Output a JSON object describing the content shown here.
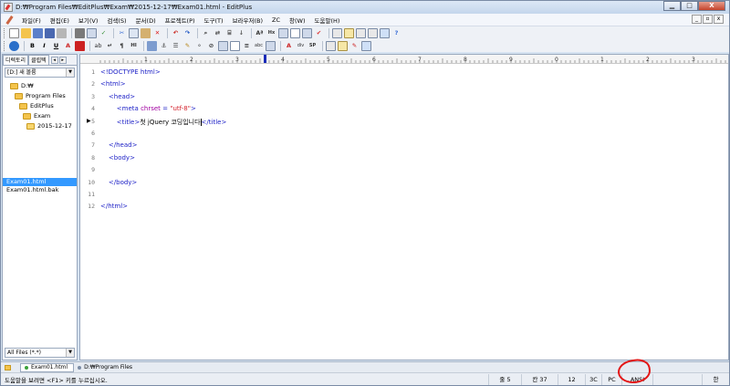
{
  "window": {
    "title": "D:₩Program Files₩EditPlus₩Exam₩2015-12-17₩Exam01.html - EditPlus",
    "buttons": [
      "▁",
      "□",
      "X"
    ]
  },
  "menu": {
    "items": [
      "파일(F)",
      "편집(E)",
      "보기(V)",
      "검색(S)",
      "문서(D)",
      "프로젝트(P)",
      "도구(T)",
      "브라우저(B)",
      "ZC",
      "창(W)",
      "도움말(H)"
    ],
    "mdi_buttons": [
      "_",
      "▫",
      "x"
    ]
  },
  "toolbar2": {
    "labels": [
      "B",
      "I",
      "U",
      "A",
      "ab",
      "¶",
      "Hl",
      "abc",
      "div",
      "SP"
    ]
  },
  "left_panel": {
    "tabs": [
      "디렉토리",
      "클립텍"
    ],
    "drive_select": "[D:] 새 볼륨",
    "tree": [
      "D:₩",
      "Program Files",
      "EditPlus",
      "Exam",
      "2015-12-17"
    ],
    "files": [
      "Exam01.html",
      "Exam01.html.bak"
    ],
    "filter": "All Files (*.*)"
  },
  "ruler": {
    "labels": [
      "1",
      "2",
      "3",
      "4",
      "5",
      "6",
      "7",
      "8",
      "9",
      "0",
      "1",
      "2",
      "3"
    ]
  },
  "editor": {
    "line_numbers": [
      "1",
      "2",
      "3",
      "4",
      "5",
      "6",
      "7",
      "8",
      "9",
      "10",
      "11",
      "12"
    ],
    "lines": [
      [
        {
          "t": "<!DOCTYPE html>",
          "c": "tag"
        }
      ],
      [
        {
          "t": "<html>",
          "c": "tag"
        }
      ],
      [
        {
          "t": "    <head>",
          "c": "tag"
        }
      ],
      [
        {
          "t": "        <meta ",
          "c": "tag"
        },
        {
          "t": "chrset",
          "c": "attr"
        },
        {
          "t": " = ",
          "c": "tag"
        },
        {
          "t": "\"utf-8\"",
          "c": "val"
        },
        {
          "t": ">",
          "c": "tag"
        }
      ],
      [
        {
          "t": "        <title>",
          "c": "tag"
        },
        {
          "t": "첫 jQuery 코딩입니다",
          "c": "txt"
        },
        {
          "t": "|",
          "c": "caret"
        },
        {
          "t": "</title>",
          "c": "tag"
        }
      ],
      [],
      [
        {
          "t": "    </head>",
          "c": "tag"
        }
      ],
      [
        {
          "t": "    <body>",
          "c": "tag"
        }
      ],
      [],
      [
        {
          "t": "    </body>",
          "c": "tag"
        }
      ],
      [],
      [
        {
          "t": "</html>",
          "c": "tag"
        }
      ]
    ]
  },
  "doc_tabs": [
    {
      "label": "Exam01.html",
      "active": true
    },
    {
      "label": "D:₩Program Files",
      "active": false
    }
  ],
  "status": {
    "help": "도움말을 보려면 <F1> 키를 누르십시오.",
    "line": "줄 5",
    "col": "칸 37",
    "num": "12",
    "cells": [
      "3C",
      "PC",
      "ANSI",
      "",
      "한"
    ]
  },
  "colors": {
    "tag": "#1e22c7",
    "attr": "#a000a0",
    "value": "#d4212c",
    "annotation": "#e31616",
    "selection": "#3399ff"
  }
}
